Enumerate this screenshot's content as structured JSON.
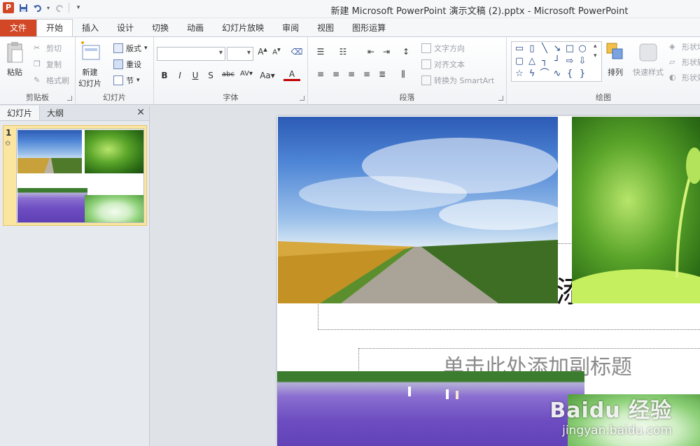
{
  "window": {
    "title": "新建 Microsoft PowerPoint 演示文稿 (2).pptx  -  Microsoft PowerPoint",
    "app_logo_letter": "P"
  },
  "tabs": {
    "file": "文件",
    "items": [
      "开始",
      "插入",
      "设计",
      "切换",
      "动画",
      "幻灯片放映",
      "审阅",
      "视图",
      "图形运算"
    ],
    "active_index": 0
  },
  "ribbon": {
    "clipboard": {
      "paste": "粘贴",
      "cut": "剪切",
      "copy": "复制",
      "format_painter": "格式刷",
      "label": "剪贴板"
    },
    "slides": {
      "new_slide_line1": "新建",
      "new_slide_line2": "幻灯片",
      "layout": "版式",
      "reset": "重设",
      "section": "节",
      "label": "幻灯片"
    },
    "font": {
      "label": "字体"
    },
    "paragraph": {
      "text_direction": "文字方向",
      "align_text": "对齐文本",
      "smartart": "转换为 SmartArt",
      "label": "段落"
    },
    "drawing": {
      "arrange": "排列",
      "quick_styles": "快速样式",
      "shape_fill": "形状填",
      "shape_outline": "形状轮",
      "shape_effects": "形状效",
      "label": "绘图"
    }
  },
  "left_panel": {
    "tab_slides": "幻灯片",
    "tab_outline": "大纲",
    "slide_number": "1",
    "close_glyph": "✕"
  },
  "slide": {
    "title_glyph": "添",
    "subtitle_placeholder": "单击此处添加副标题"
  },
  "watermark": {
    "main": "Baidu 经验",
    "sub": "jingyan.baidu.com"
  },
  "icons": [
    "ppt-logo-icon",
    "save-icon",
    "undo-icon",
    "redo-icon",
    "customize-qat-icon",
    "paste-icon",
    "cut-icon",
    "copy-icon",
    "format-painter-icon",
    "new-slide-icon",
    "layout-icon",
    "reset-icon",
    "section-icon",
    "close-icon",
    "star-icon"
  ],
  "colors": {
    "file_tab": "#d24726",
    "selected_thumb": "#fbe6a1"
  }
}
